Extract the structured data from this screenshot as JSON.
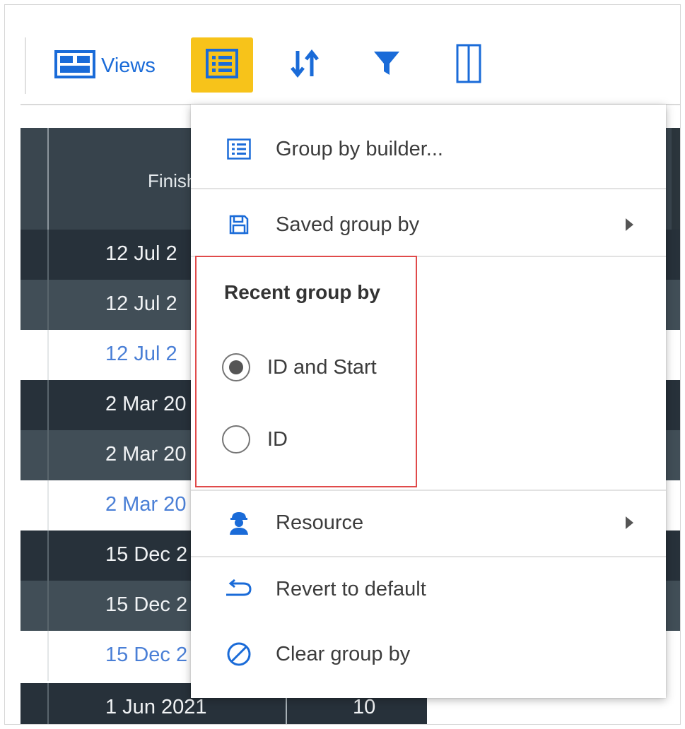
{
  "toolbar": {
    "views_label": "Views",
    "buttons": [
      {
        "name": "group-by-button",
        "icon": "list-icon",
        "active": true
      },
      {
        "name": "sort-button",
        "icon": "sort-arrows-icon",
        "active": false
      },
      {
        "name": "filter-button",
        "icon": "filter-icon",
        "active": false
      },
      {
        "name": "columns-button",
        "icon": "columns-icon",
        "active": false
      }
    ]
  },
  "table": {
    "header_partial": "Finish",
    "rows": [
      {
        "date": "12 Jul 2",
        "style": "dark"
      },
      {
        "date": "12 Jul 2",
        "style": "mid"
      },
      {
        "date": "12 Jul 2",
        "style": "light"
      },
      {
        "date": "2 Mar 20",
        "style": "dark"
      },
      {
        "date": "2 Mar 20",
        "style": "mid"
      },
      {
        "date": "2 Mar 20",
        "style": "light"
      },
      {
        "date": "15 Dec 2",
        "style": "dark"
      },
      {
        "date": "15 Dec 2",
        "style": "mid"
      },
      {
        "date": "15 Dec 2",
        "style": "light"
      }
    ],
    "last_row": {
      "date": "1 Jun 2021",
      "value": "10"
    }
  },
  "menu": {
    "group_by_builder": "Group by builder...",
    "saved_group_by": "Saved group by",
    "recent_title": "Recent group by",
    "recent_options": [
      {
        "label": "ID and Start",
        "checked": true
      },
      {
        "label": "ID",
        "checked": false
      }
    ],
    "resource": "Resource",
    "revert": "Revert to default",
    "clear": "Clear group by"
  },
  "colors": {
    "accent": "#1a6bd8",
    "active_button": "#f7c31a",
    "highlight_border": "#e04a4a",
    "table_dark": "#27313a",
    "table_mid": "#414e57"
  }
}
